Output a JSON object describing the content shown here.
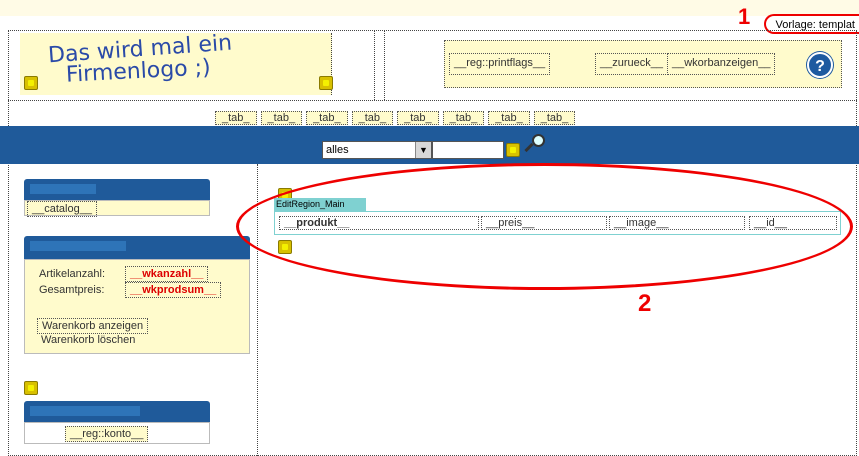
{
  "template_label": "Vorlage: templat",
  "annotation_1": "1",
  "annotation_2": "2",
  "logo": {
    "line1": "Das wird mal ein",
    "line2": "Firmenlogo ;)"
  },
  "header_flags": {
    "printflags": "__reg::printflags__",
    "zurueck": "__zurueck__",
    "wkorbanzeigen": "__wkorbanzeigen__",
    "help": "?"
  },
  "tabs": [
    "_tab_",
    "_tab_",
    "_tab_",
    "_tab_",
    "_tab_",
    "_tab_",
    "_tab_",
    "_tab_"
  ],
  "search": {
    "selected": "alles"
  },
  "sidebar": {
    "catalog": "__catalog__",
    "cart": {
      "articles_label": "Artikelanzahl:",
      "articles_value": "__wkanzahl__",
      "total_label": "Gesamtpreis:",
      "total_value": "__wkprodsum__",
      "show": "Warenkorb anzeigen",
      "clear": "Warenkorb löschen"
    },
    "account": "__reg::konto__"
  },
  "edit_region": {
    "label": "EditRegion_Main",
    "columns": [
      "__produkt__",
      "__preis__",
      "__image__",
      "__id__"
    ]
  },
  "colors": {
    "accent_blue": "#1f5a9a",
    "panel_yellow": "#fffbcc",
    "annotation_red": "#e00000"
  }
}
